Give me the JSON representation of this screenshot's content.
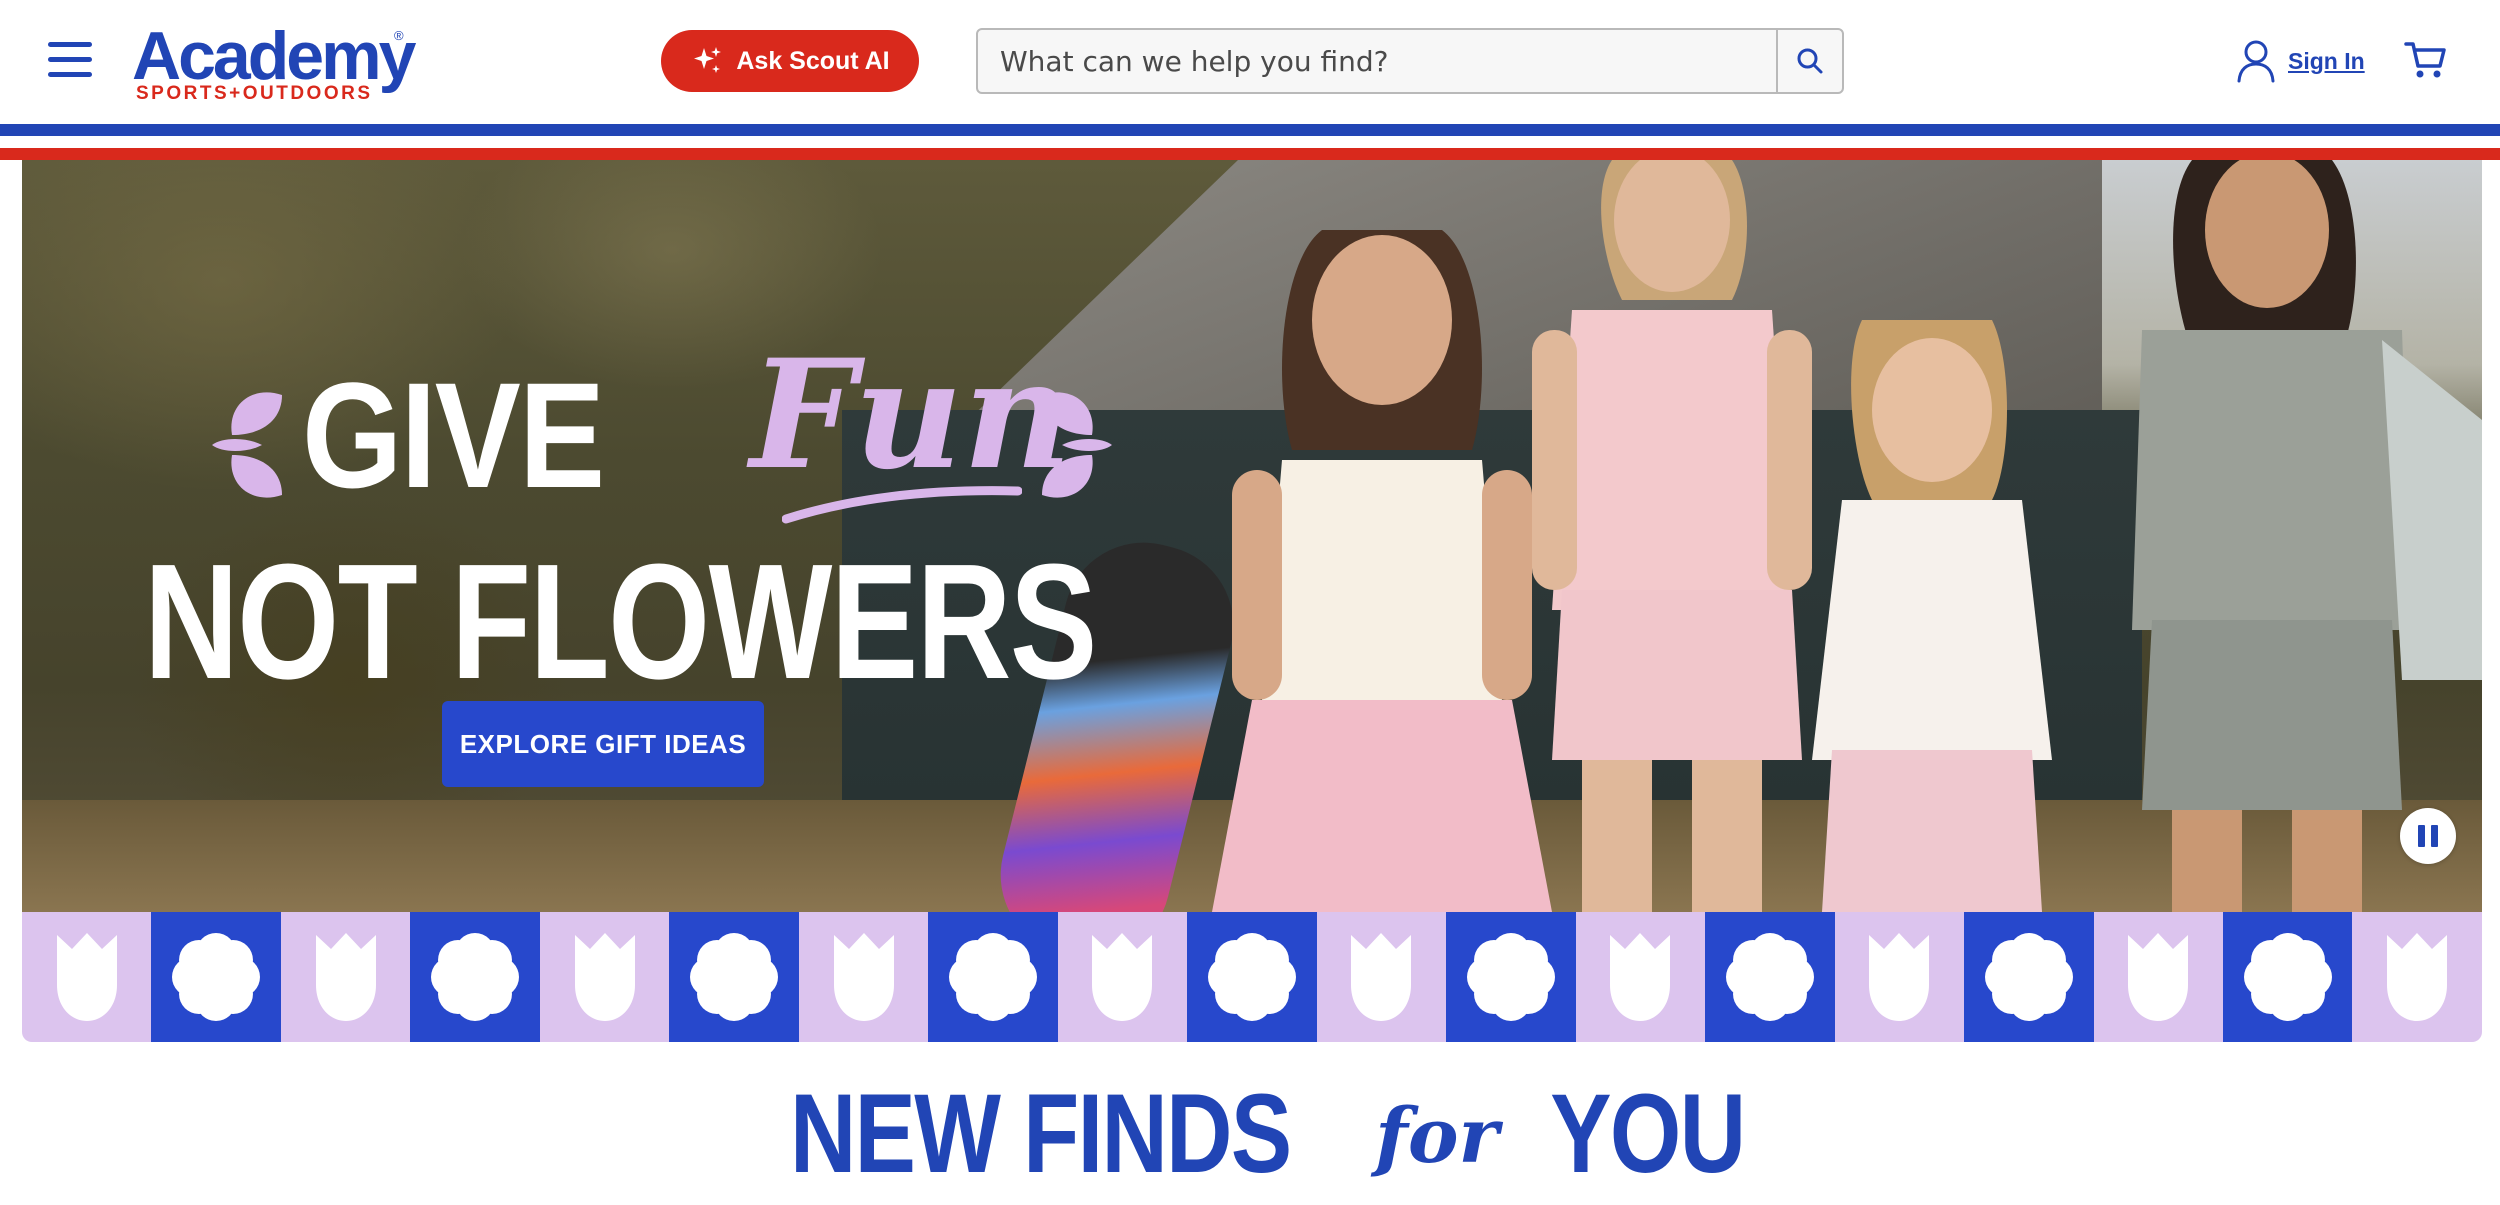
{
  "brand": {
    "name": "Academy",
    "tagline": "SPORTS+OUTDOORS",
    "registered": "®",
    "colors": {
      "blue": "#2145b5",
      "red": "#d9291c",
      "lavender": "#dcc4ee"
    }
  },
  "header": {
    "menu_icon": "hamburger-menu-icon",
    "scout_label": "Ask Scout AI",
    "scout_icon": "sparkle-icon",
    "search": {
      "placeholder": "What can we help you find?",
      "value": "",
      "icon": "search-icon"
    },
    "signin_label": "Sign In",
    "account_icon": "user-icon",
    "cart_icon": "cart-icon"
  },
  "hero": {
    "line1_a": "GIVE",
    "line1_b": "Fun",
    "line2": "NOT FLOWERS",
    "cta_label": "EXPLORE GIFT IDEAS",
    "pause_icon": "pause-icon"
  },
  "pattern": {
    "tiles": [
      "tulip",
      "flower",
      "tulip",
      "flower",
      "tulip",
      "flower",
      "tulip",
      "flower",
      "tulip",
      "flower",
      "tulip",
      "flower",
      "tulip",
      "flower",
      "tulip",
      "flower",
      "tulip",
      "flower",
      "tulip"
    ]
  },
  "section": {
    "title_a": "NEW FINDS",
    "title_for": "for",
    "title_b": "YOU"
  }
}
